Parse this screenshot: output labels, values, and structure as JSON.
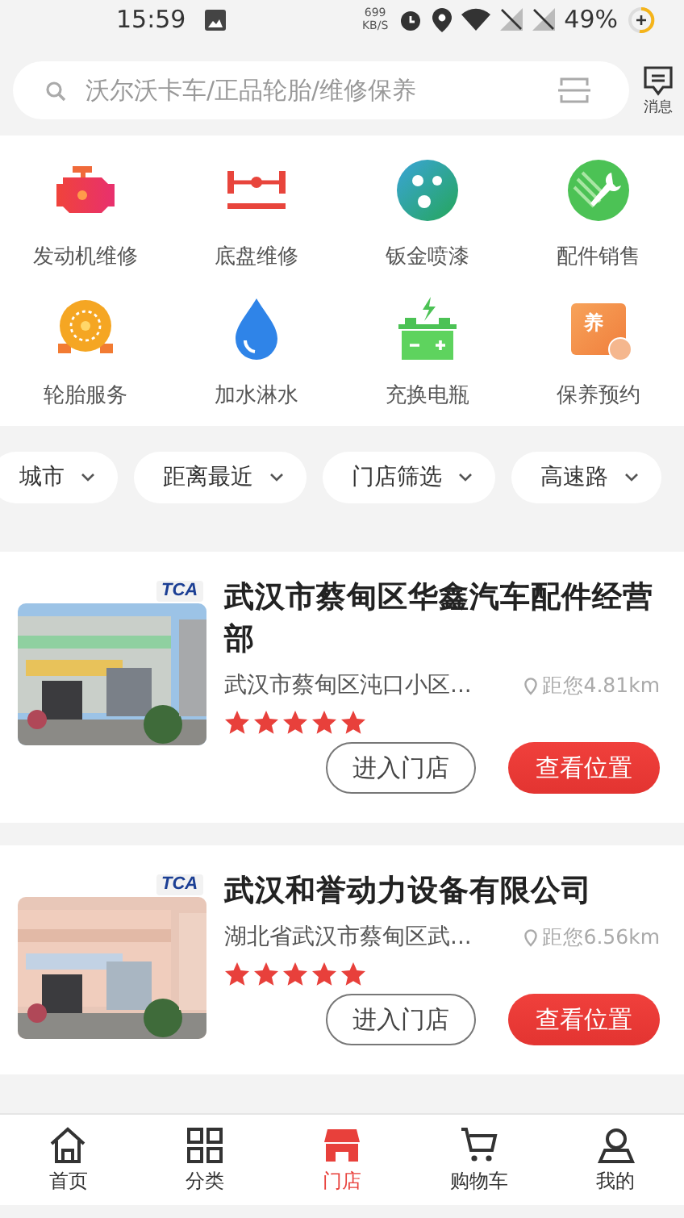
{
  "status_bar": {
    "time": "15:59",
    "speed": "699",
    "speed_unit": "KB/S",
    "battery": "49%"
  },
  "search": {
    "placeholder": "沃尔沃卡车/正品轮胎/维修保养",
    "messages_label": "消息"
  },
  "categories": [
    {
      "label": "发动机维修"
    },
    {
      "label": "底盘维修"
    },
    {
      "label": "钣金喷漆"
    },
    {
      "label": "配件销售"
    },
    {
      "label": "轮胎服务"
    },
    {
      "label": "加水淋水"
    },
    {
      "label": "充换电瓶"
    },
    {
      "label": "保养预约",
      "icon_text": "养"
    }
  ],
  "filters": [
    {
      "label": "城市"
    },
    {
      "label": "距离最近"
    },
    {
      "label": "门店筛选"
    },
    {
      "label": "高速路"
    }
  ],
  "stores": [
    {
      "badge": "TCA",
      "name": "武汉市蔡甸区华鑫汽车配件经营部",
      "address": "武汉市蔡甸区沌口小区...",
      "distance": "距您4.81km",
      "stars": 5,
      "enter": "进入门店",
      "locate": "查看位置"
    },
    {
      "badge": "TCA",
      "name": "武汉和誉动力设备有限公司",
      "address": "湖北省武汉市蔡甸区武...",
      "distance": "距您6.56km",
      "stars": 5,
      "enter": "进入门店",
      "locate": "查看位置"
    }
  ],
  "tabs": [
    {
      "label": "首页",
      "selected": false
    },
    {
      "label": "分类",
      "selected": false
    },
    {
      "label": "门店",
      "selected": true
    },
    {
      "label": "购物车",
      "selected": false
    },
    {
      "label": "我的",
      "selected": false
    }
  ]
}
